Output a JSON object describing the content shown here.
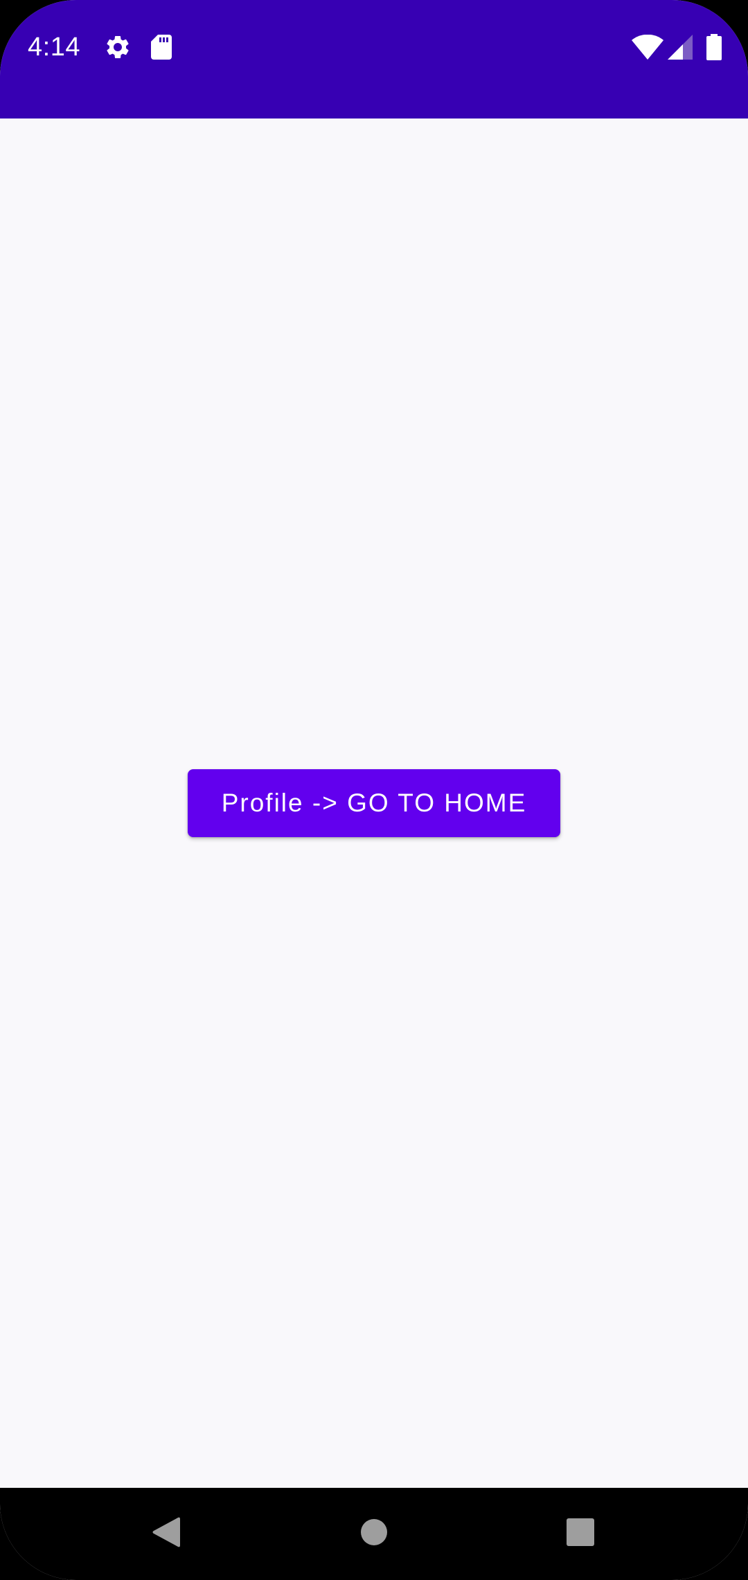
{
  "status_bar": {
    "time": "4:14",
    "background_color": "#3700b3",
    "left_icons": [
      "gear-icon",
      "sd-card-icon"
    ],
    "right_icons": [
      "wifi-icon",
      "cell-signal-icon",
      "battery-icon"
    ]
  },
  "main": {
    "background_color": "#f9f8fb",
    "button_label": "Profile -> GO TO HOME",
    "button_color": "#6200ee",
    "button_text_color": "#ffffff"
  },
  "nav_bar": {
    "background_color": "#000000",
    "buttons": [
      "back-icon",
      "home-icon",
      "recents-icon"
    ],
    "icon_color": "#9e9e9e"
  }
}
